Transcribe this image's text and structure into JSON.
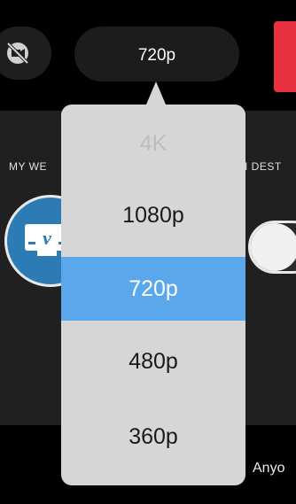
{
  "top_bar": {
    "quality_label": "720p"
  },
  "sections": {
    "left_label": "MY WE",
    "right_label": "I DEST"
  },
  "bottom": {
    "privacy_label": "Anyo"
  },
  "quality_menu": {
    "selected": "720p",
    "options": [
      {
        "label": "4K",
        "state": "disabled"
      },
      {
        "label": "1080p",
        "state": "normal"
      },
      {
        "label": "720p",
        "state": "selected"
      },
      {
        "label": "480p",
        "state": "normal"
      },
      {
        "label": "360p",
        "state": "normal"
      }
    ]
  },
  "colors": {
    "accent_selected": "#5aa8eb",
    "go_live": "#e8323f",
    "platform": "#2d7bb5"
  },
  "icons": {
    "hide_camera": "camera-off-icon",
    "platform": "vimeo-icon"
  }
}
